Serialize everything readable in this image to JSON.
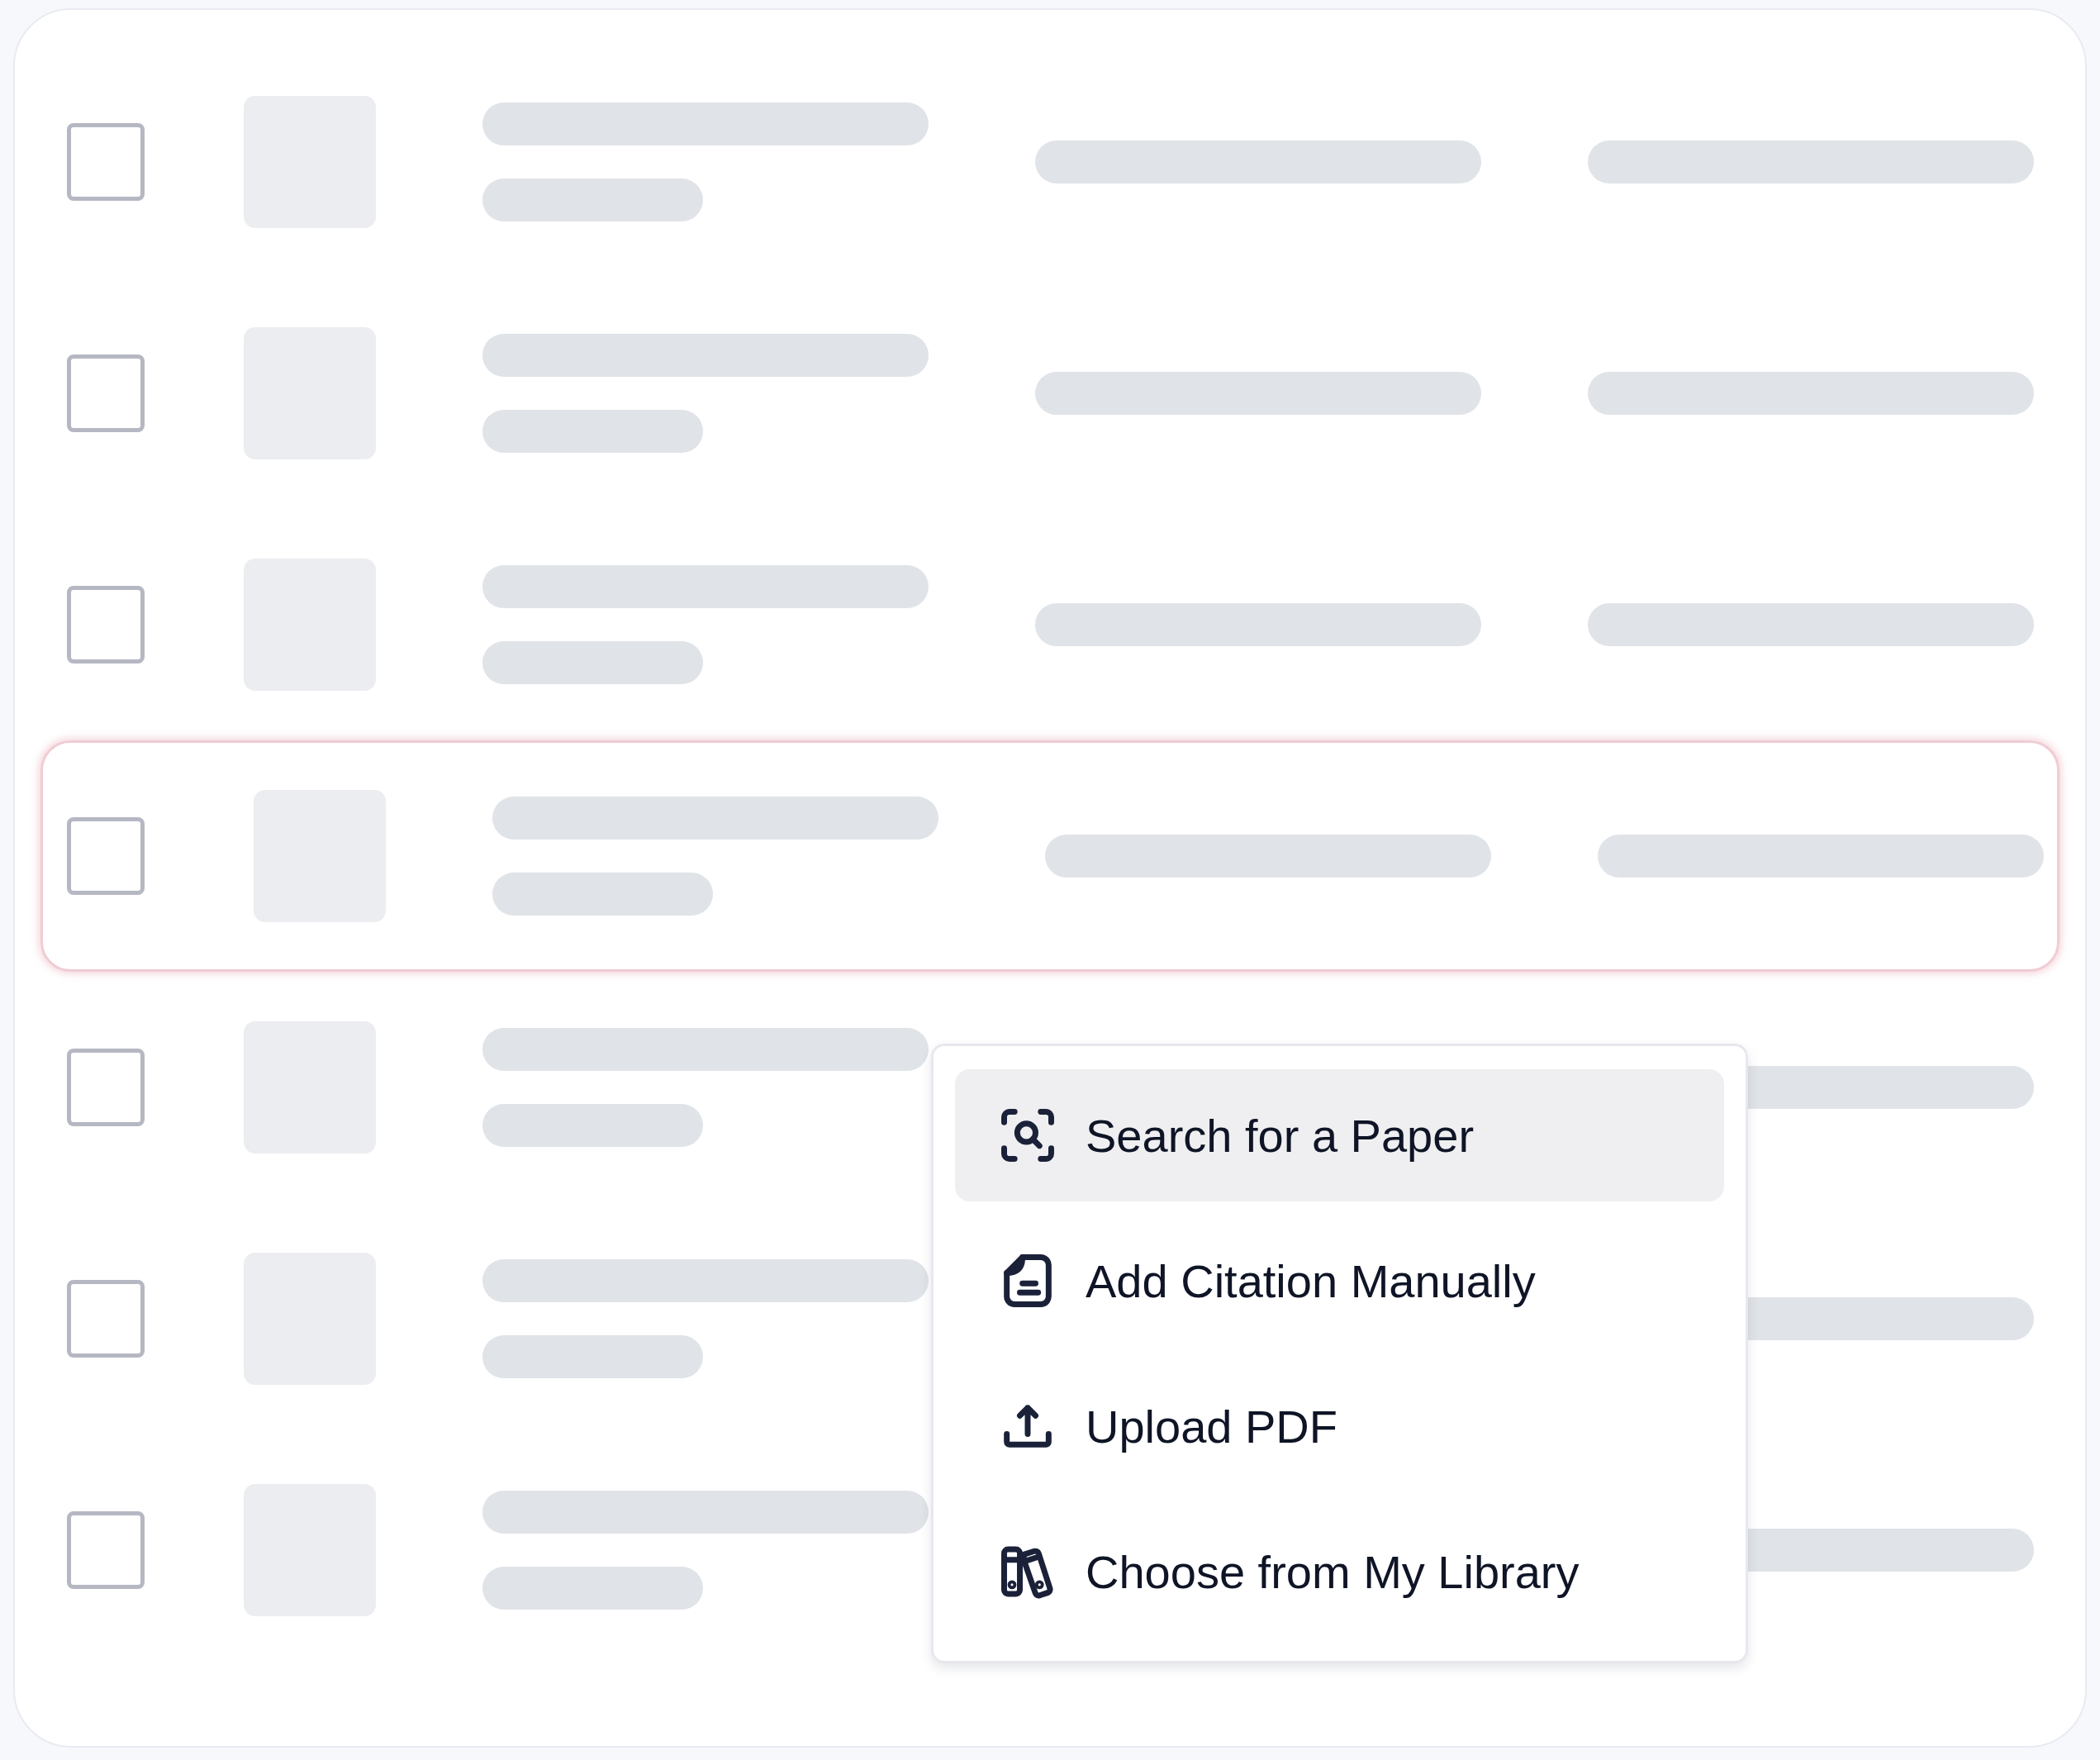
{
  "rows": [
    {
      "checked": false,
      "selected": false
    },
    {
      "checked": false,
      "selected": false
    },
    {
      "checked": false,
      "selected": false
    },
    {
      "checked": false,
      "selected": true
    },
    {
      "checked": false,
      "selected": false
    },
    {
      "checked": false,
      "selected": false
    },
    {
      "checked": false,
      "selected": false
    }
  ],
  "menu": {
    "items": [
      {
        "kind": "search",
        "label": "Search for a Paper",
        "selected": true
      },
      {
        "kind": "note",
        "label": "Add Citation Manually",
        "selected": false
      },
      {
        "kind": "upload",
        "label": "Upload PDF",
        "selected": false
      },
      {
        "kind": "library",
        "label": "Choose from My Library",
        "selected": false
      }
    ]
  }
}
